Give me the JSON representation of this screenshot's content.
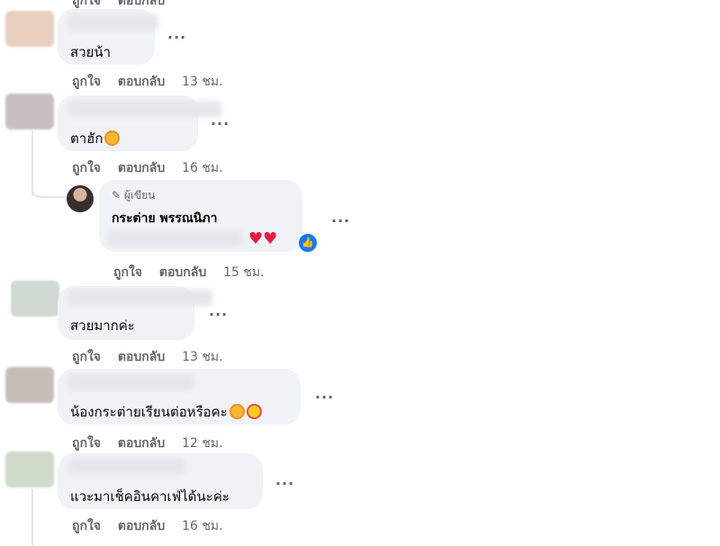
{
  "actions": {
    "like": "ถูกใจ",
    "reply": "ตอบกลับ"
  },
  "comments": [
    {
      "text": "สวยน้า",
      "time": "13 ชม."
    },
    {
      "text": "ตาฮัก",
      "time": "16 ชม."
    },
    {
      "author_badge": "ผู้เขียน",
      "author": "กระต่าย พรรณนิภา",
      "time": "15 ชม."
    },
    {
      "text": "สวยมากค่ะ",
      "time": "13 ชม."
    },
    {
      "text": "น้องกระต่ายเรียนต่อหรือคะ",
      "time": "12 ชม."
    },
    {
      "text": "แวะมาเช็คอินคาเฟ่ได้นะค่ะ",
      "time": "16 ชม."
    }
  ],
  "more_label": "...",
  "icons": [
    "more-options-icon",
    "pencil-icon",
    "like-reaction-icon",
    "heart-emoji-icon",
    "smiling-face-with-hearts-icon",
    "heart-eyes-emoji-icon"
  ]
}
